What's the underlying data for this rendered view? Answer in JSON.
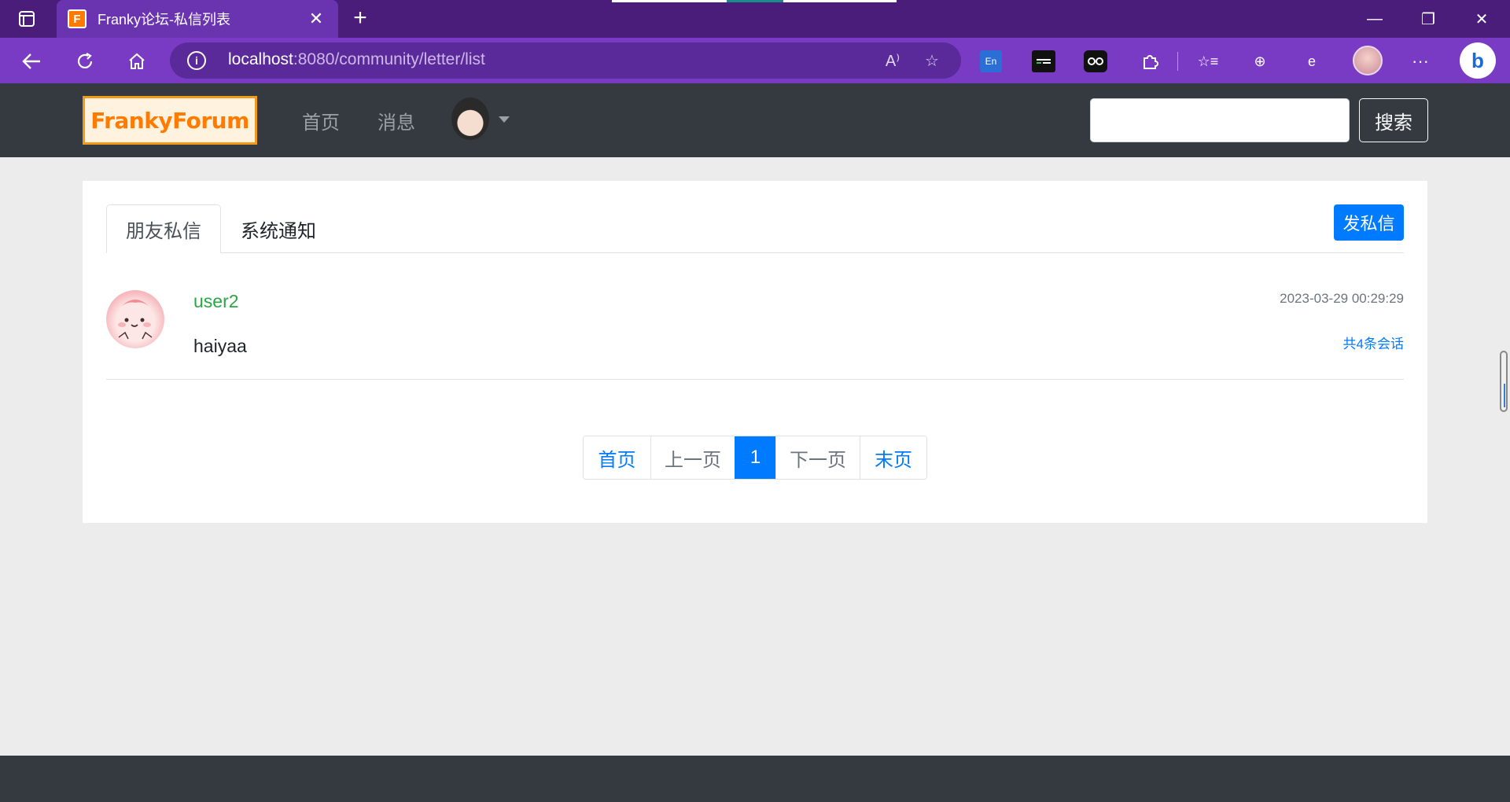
{
  "browser": {
    "tab_title": "Franky论坛-私信列表",
    "tab_favicon_letter": "F",
    "url_host": "localhost",
    "url_path": ":8080/community/letter/list",
    "icons": [
      "tab-actions-icon",
      "close-icon",
      "plus-icon",
      "minimize-icon",
      "restore-icon",
      "window-close-icon",
      "back-icon",
      "refresh-icon",
      "home-icon",
      "info-icon",
      "read-aloud-icon",
      "add-favorite-icon",
      "translate-extension-icon",
      "extension-icon",
      "extensions-puzzle-icon",
      "favorites-icon",
      "collections-icon",
      "ie-mode-icon",
      "more-icon",
      "bing-icon"
    ]
  },
  "header": {
    "logo_text": "FrankyForum",
    "nav": {
      "home": "首页",
      "messages": "消息"
    },
    "search": {
      "value": "",
      "button_label": "搜索"
    }
  },
  "main": {
    "tabs": [
      {
        "label": "朋友私信",
        "active": true
      },
      {
        "label": "系统通知",
        "active": false
      }
    ],
    "send_button": "发私信",
    "messages": [
      {
        "username": "user2",
        "content": "haiyaa",
        "time": "2023-03-29 00:29:29",
        "count_label": "共4条会话"
      }
    ],
    "pagination": {
      "first": "首页",
      "prev": "上一页",
      "current": "1",
      "next": "下一页",
      "last": "末页"
    }
  },
  "colors": {
    "browser_tabstrip": "#4a1d7a",
    "browser_toolbar": "#7a3bc4",
    "site_header": "#343a40",
    "primary": "#007bff",
    "username_green": "#28a745",
    "logo_orange": "#ff7a00"
  }
}
